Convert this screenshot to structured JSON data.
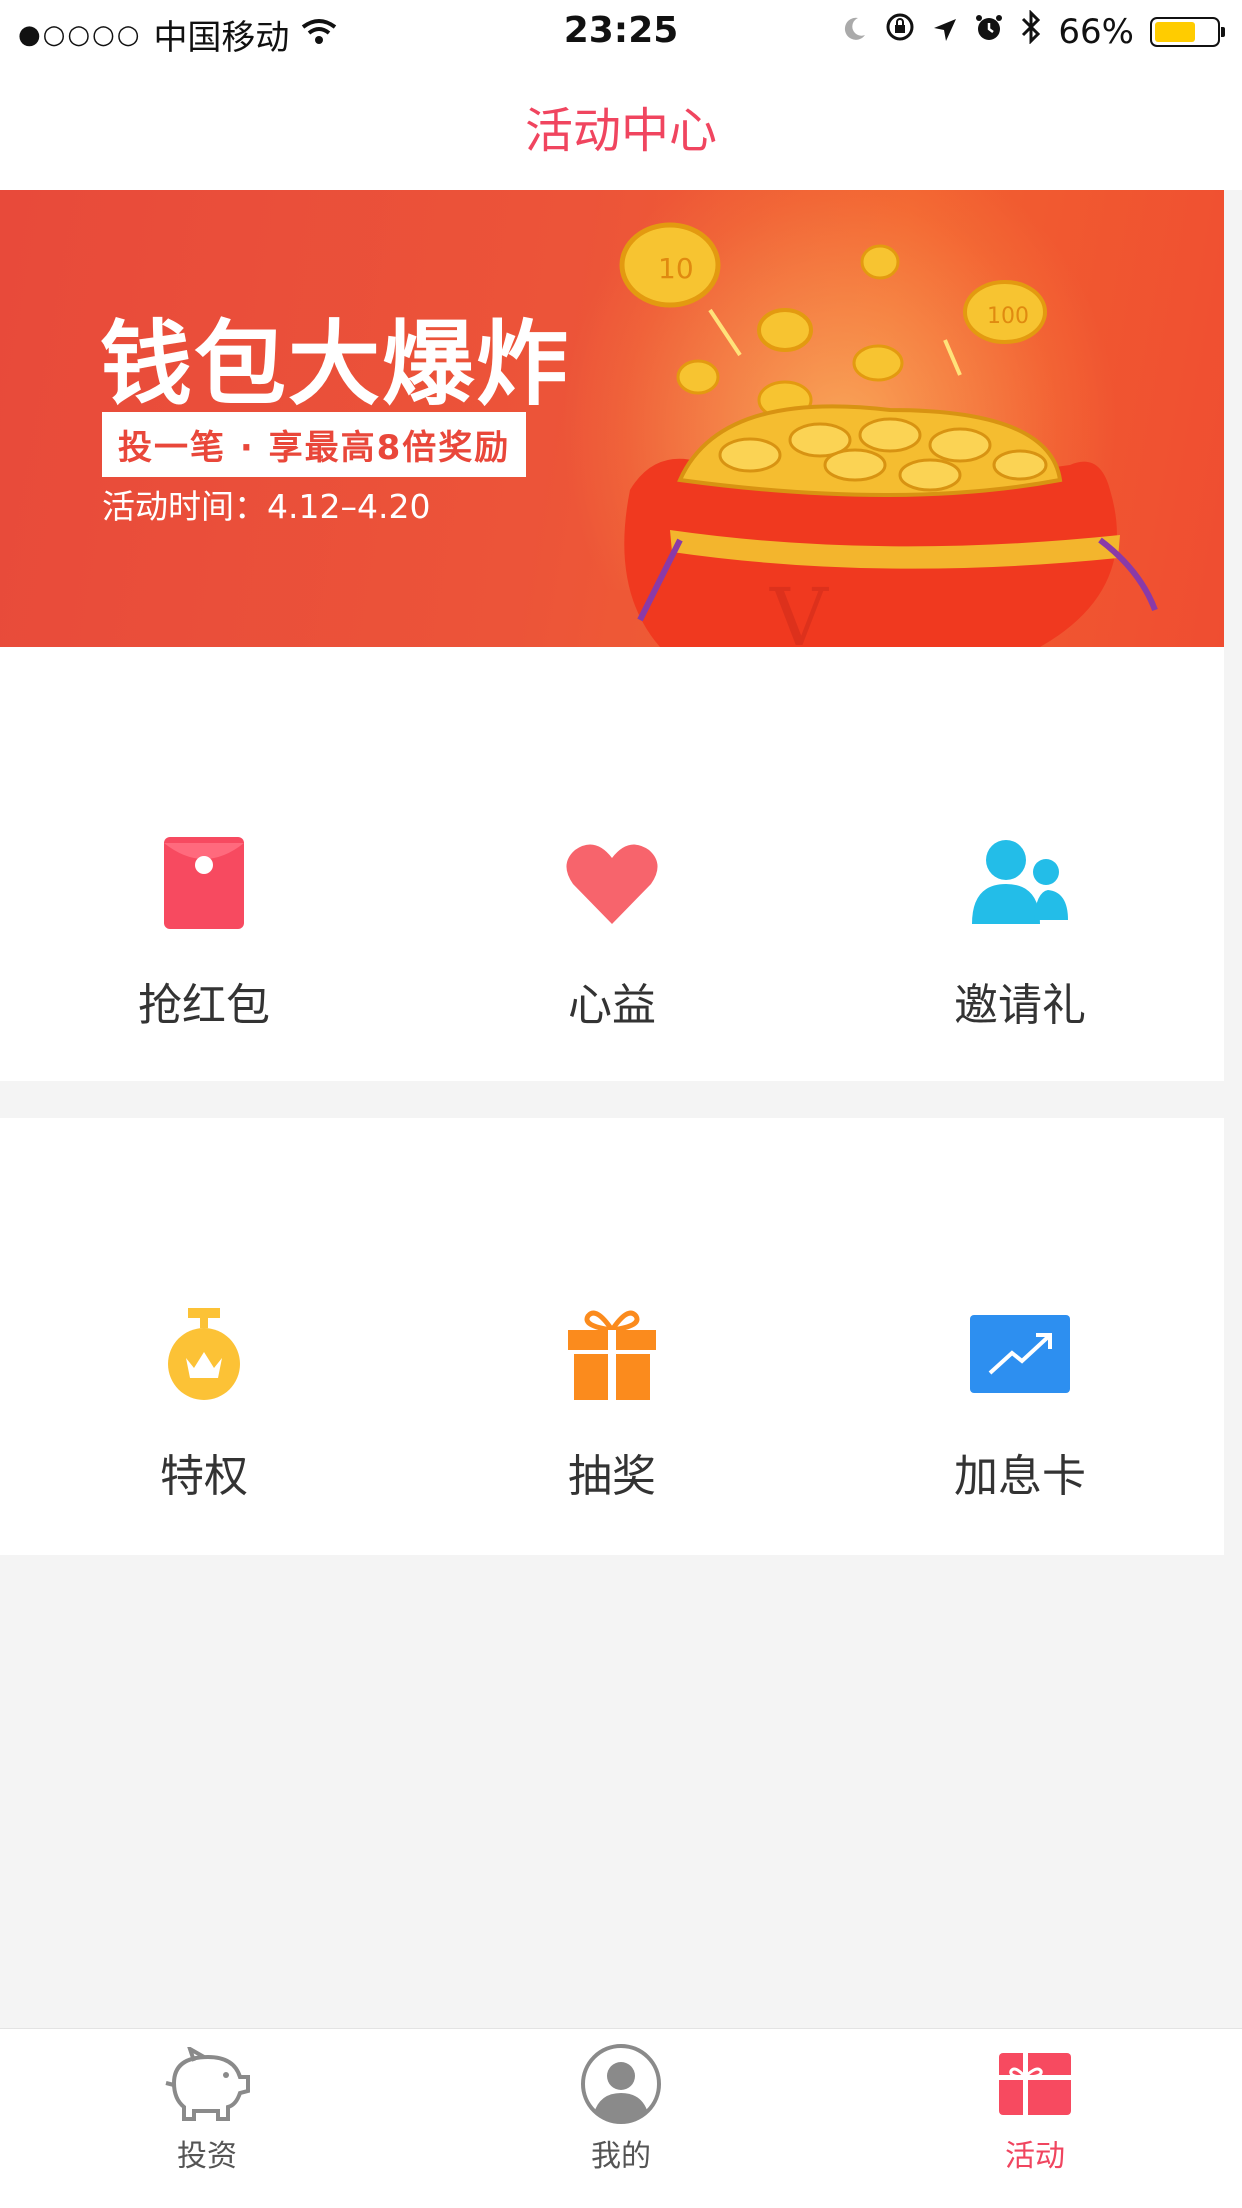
{
  "status_bar": {
    "signal": "●○○○○",
    "carrier": "中国移动",
    "time": "23:25",
    "battery_text": "66%",
    "battery_level": 0.66
  },
  "header": {
    "title": "活动中心"
  },
  "banner": {
    "title": "钱包大爆炸",
    "subtitle": "投一笔 · 享最高8倍奖励",
    "time": "活动时间：4.12–4.20"
  },
  "grid_row1": [
    {
      "label": "抢红包",
      "icon": "red-envelope-icon",
      "color": "#f74a60"
    },
    {
      "label": "心益",
      "icon": "heart-icon",
      "color": "#f7646c"
    },
    {
      "label": "邀请礼",
      "icon": "people-icon",
      "color": "#23bde8"
    }
  ],
  "grid_row2": [
    {
      "label": "特权",
      "icon": "medal-crown-icon",
      "color": "#fcc236"
    },
    {
      "label": "抽奖",
      "icon": "gift-icon",
      "color": "#fb8b1d"
    },
    {
      "label": "加息卡",
      "icon": "rate-card-icon",
      "color": "#2d8ff0"
    }
  ],
  "tabs": [
    {
      "label": "投资",
      "icon": "piggy-bank-icon",
      "active": false
    },
    {
      "label": "我的",
      "icon": "user-avatar-icon",
      "active": false
    },
    {
      "label": "活动",
      "icon": "gift-box-icon",
      "active": true
    }
  ],
  "colors": {
    "accent": "#f0455f",
    "banner": "#e94c3a",
    "background": "#f4f4f4"
  }
}
